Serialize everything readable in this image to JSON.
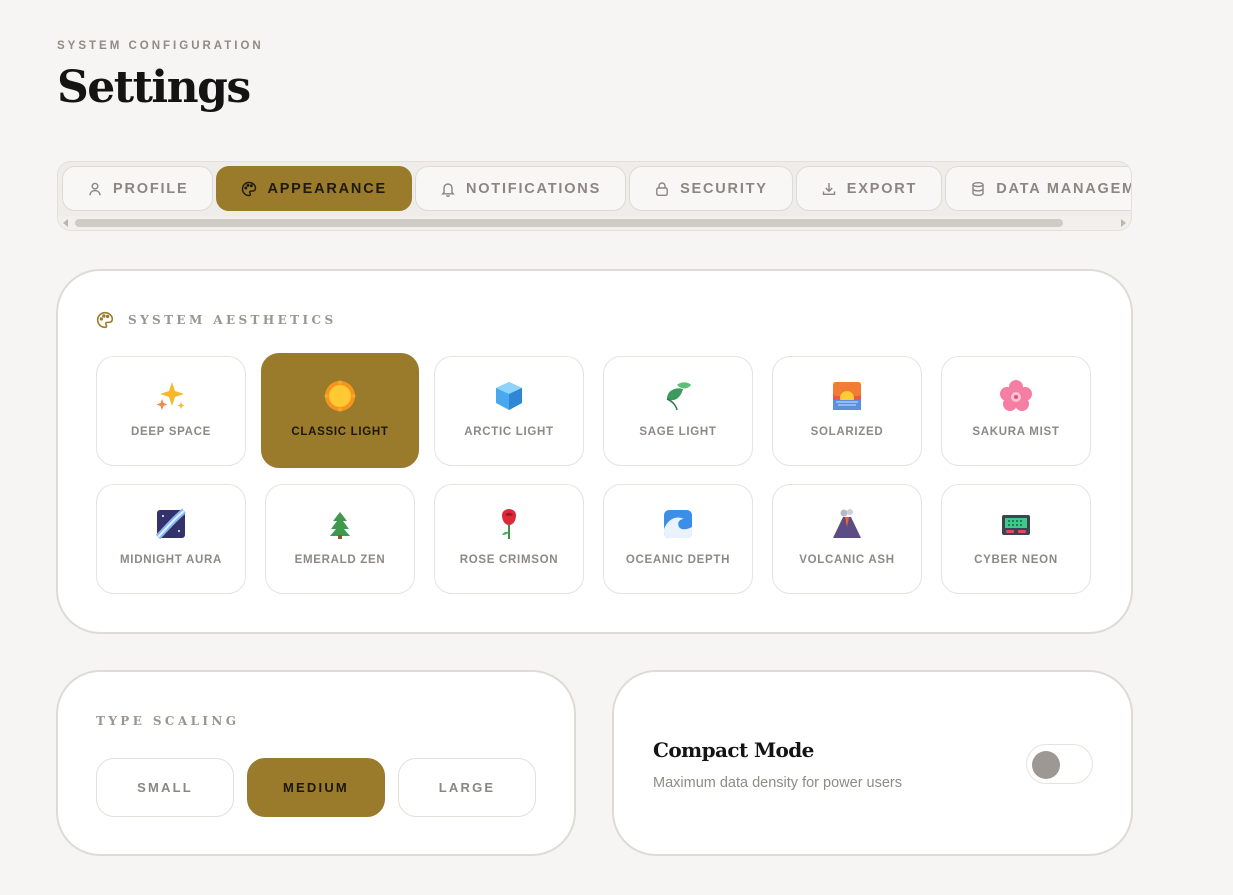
{
  "header": {
    "eyebrow": "SYSTEM CONFIGURATION",
    "title": "Settings"
  },
  "tabs": [
    {
      "label": "PROFILE",
      "icon": "user-icon",
      "active": false
    },
    {
      "label": "APPEARANCE",
      "icon": "palette-icon",
      "active": true
    },
    {
      "label": "NOTIFICATIONS",
      "icon": "bell-icon",
      "active": false
    },
    {
      "label": "SECURITY",
      "icon": "lock-icon",
      "active": false
    },
    {
      "label": "EXPORT",
      "icon": "download-icon",
      "active": false
    },
    {
      "label": "DATA MANAGEME",
      "icon": "database-icon",
      "active": false
    }
  ],
  "aesthetics": {
    "label": "SYSTEM AESTHETICS",
    "themes": [
      {
        "name": "DEEP SPACE",
        "icon": "sparkles-icon",
        "active": false
      },
      {
        "name": "CLASSIC LIGHT",
        "icon": "sun-icon",
        "active": true
      },
      {
        "name": "ARCTIC LIGHT",
        "icon": "ice-cube-icon",
        "active": false
      },
      {
        "name": "SAGE LIGHT",
        "icon": "leaf-icon",
        "active": false
      },
      {
        "name": "SOLARIZED",
        "icon": "sunrise-icon",
        "active": false
      },
      {
        "name": "SAKURA MIST",
        "icon": "cherry-blossom-icon",
        "active": false
      },
      {
        "name": "MIDNIGHT AURA",
        "icon": "milky-way-icon",
        "active": false
      },
      {
        "name": "EMERALD ZEN",
        "icon": "tree-icon",
        "active": false
      },
      {
        "name": "ROSE CRIMSON",
        "icon": "rose-icon",
        "active": false
      },
      {
        "name": "OCEANIC DEPTH",
        "icon": "wave-icon",
        "active": false
      },
      {
        "name": "VOLCANIC ASH",
        "icon": "volcano-icon",
        "active": false
      },
      {
        "name": "CYBER NEON",
        "icon": "pager-icon",
        "active": false
      }
    ]
  },
  "type_scaling": {
    "label": "TYPE SCALING",
    "options": [
      {
        "label": "SMALL",
        "active": false
      },
      {
        "label": "MEDIUM",
        "active": true
      },
      {
        "label": "LARGE",
        "active": false
      }
    ]
  },
  "compact": {
    "title": "Compact Mode",
    "description": "Maximum data density for power users",
    "enabled": false
  },
  "colors": {
    "accent": "#9a7b2b",
    "background": "#f6f5f3",
    "muted_text": "#8a8782"
  }
}
